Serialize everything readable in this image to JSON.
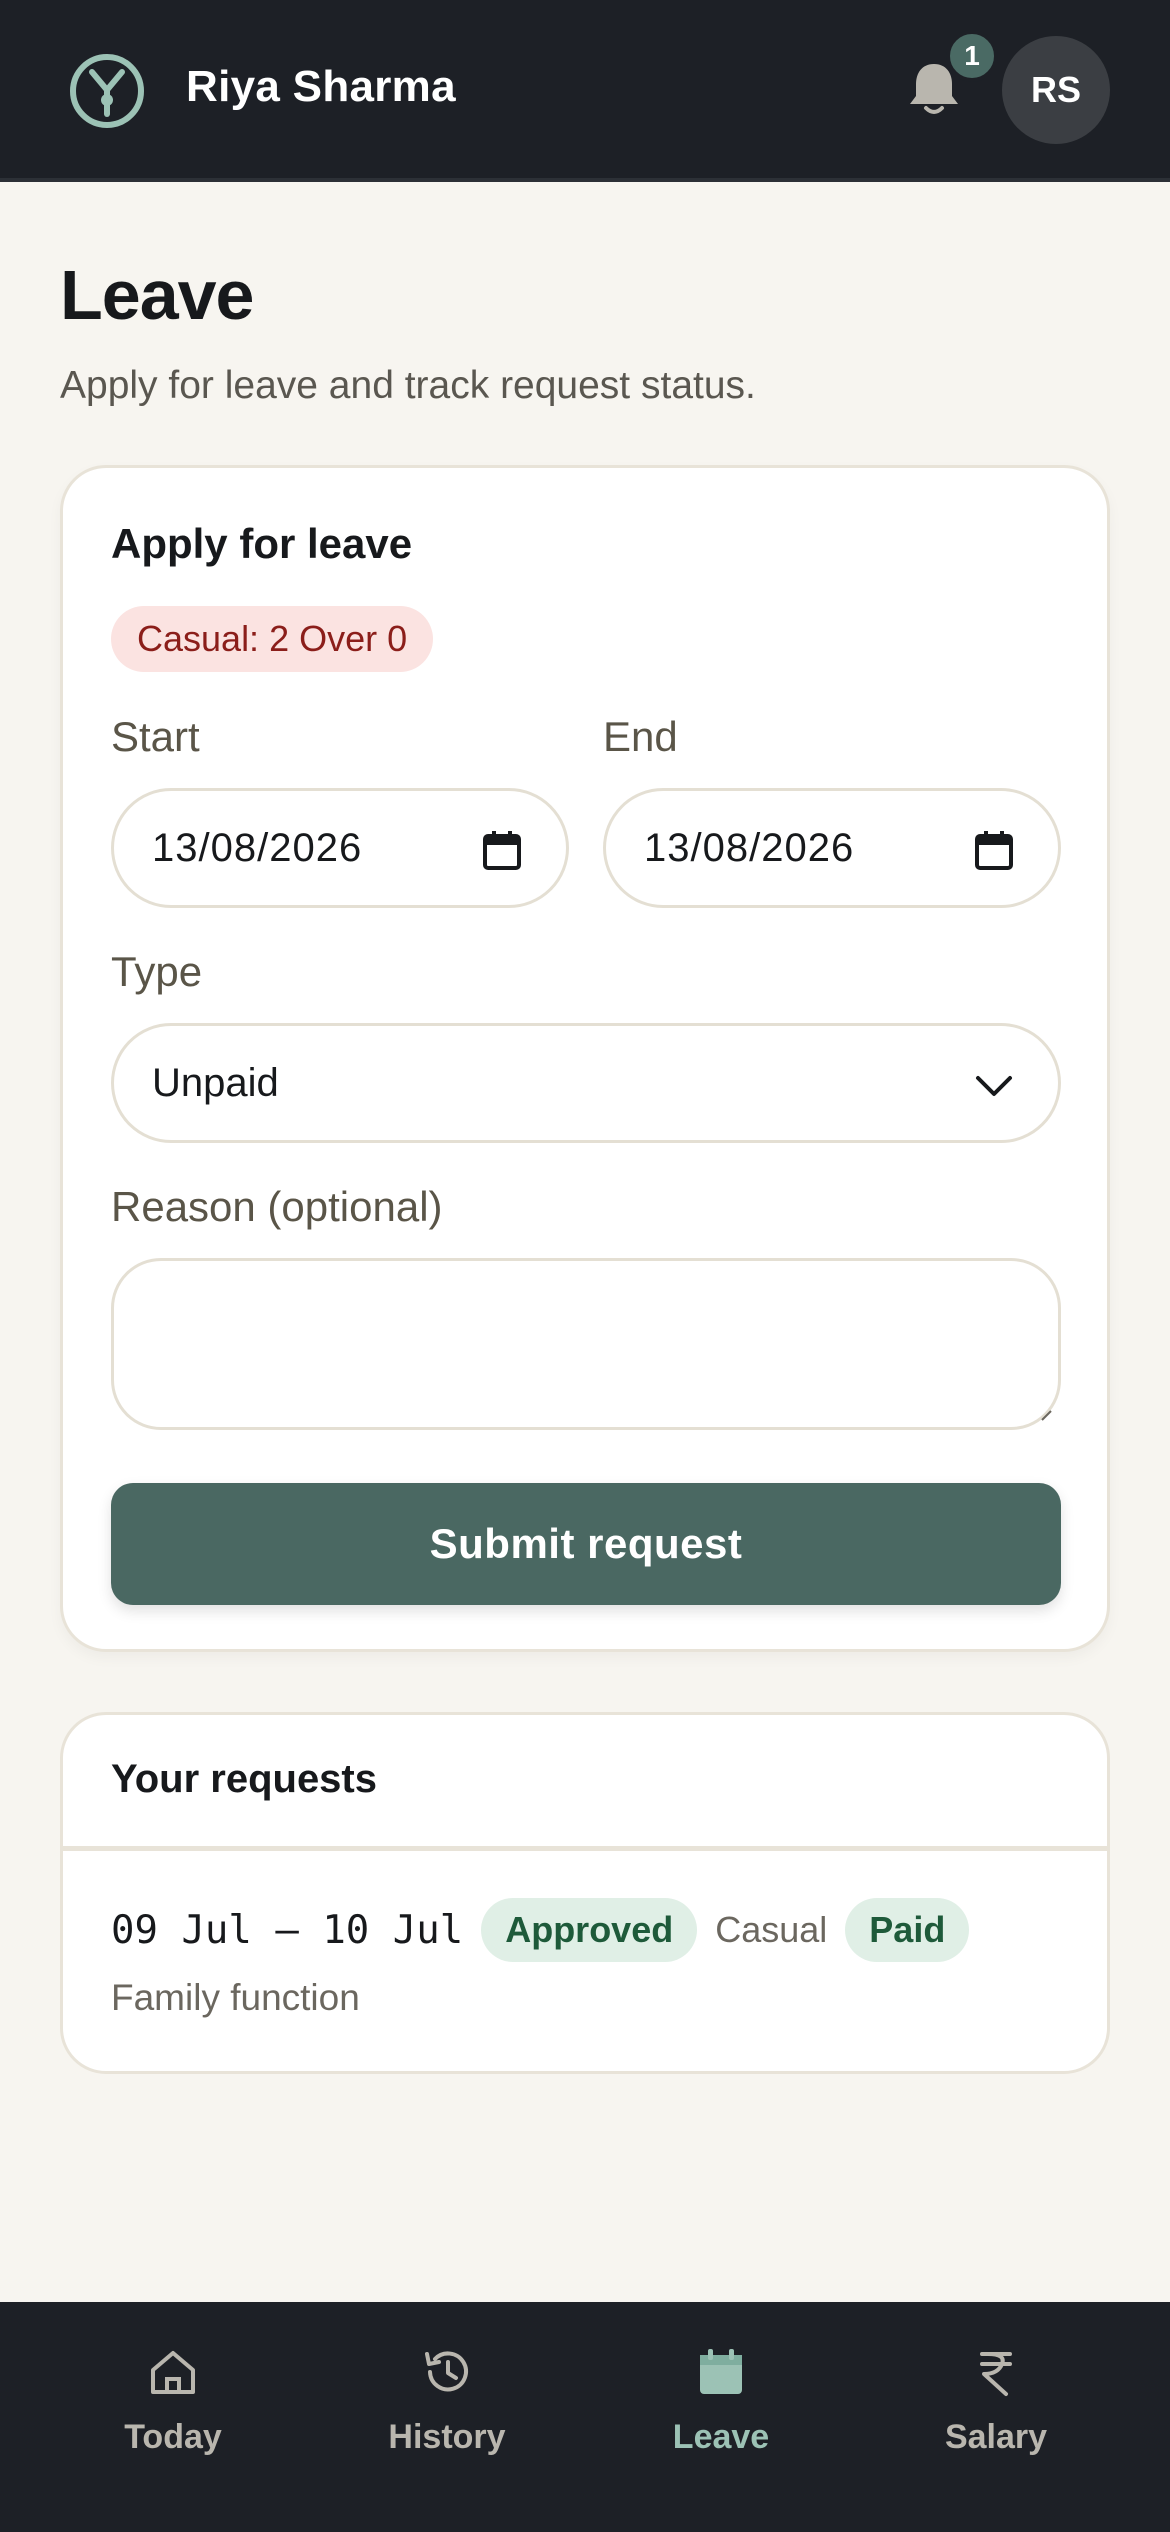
{
  "header": {
    "user_name": "Riya Sharma",
    "notification_count": "1",
    "avatar_initials": "RS",
    "colors": {
      "bar": "#1d2026",
      "accent": "#4a6a64",
      "logo": "#9cc2b5"
    }
  },
  "page": {
    "title": "Leave",
    "subtitle": "Apply for leave and track request status."
  },
  "apply_form": {
    "title": "Apply for leave",
    "balance_badge": "Casual: 2 Over 0",
    "start_label": "Start",
    "start_value": "13/08/2026",
    "end_label": "End",
    "end_value": "13/08/2026",
    "type_label": "Type",
    "type_value": "Unpaid",
    "reason_label": "Reason (optional)",
    "reason_value": "",
    "submit_label": "Submit request"
  },
  "requests": {
    "title": "Your requests",
    "items": [
      {
        "dates": "09 Jul – 10 Jul",
        "status": "Approved",
        "type": "Casual",
        "pay": "Paid",
        "reason": "Family function"
      }
    ]
  },
  "nav": {
    "items": [
      {
        "label": "Today",
        "icon": "home-icon"
      },
      {
        "label": "History",
        "icon": "history-icon"
      },
      {
        "label": "Leave",
        "icon": "calendar-icon",
        "active": true
      },
      {
        "label": "Salary",
        "icon": "rupee-icon"
      }
    ]
  }
}
